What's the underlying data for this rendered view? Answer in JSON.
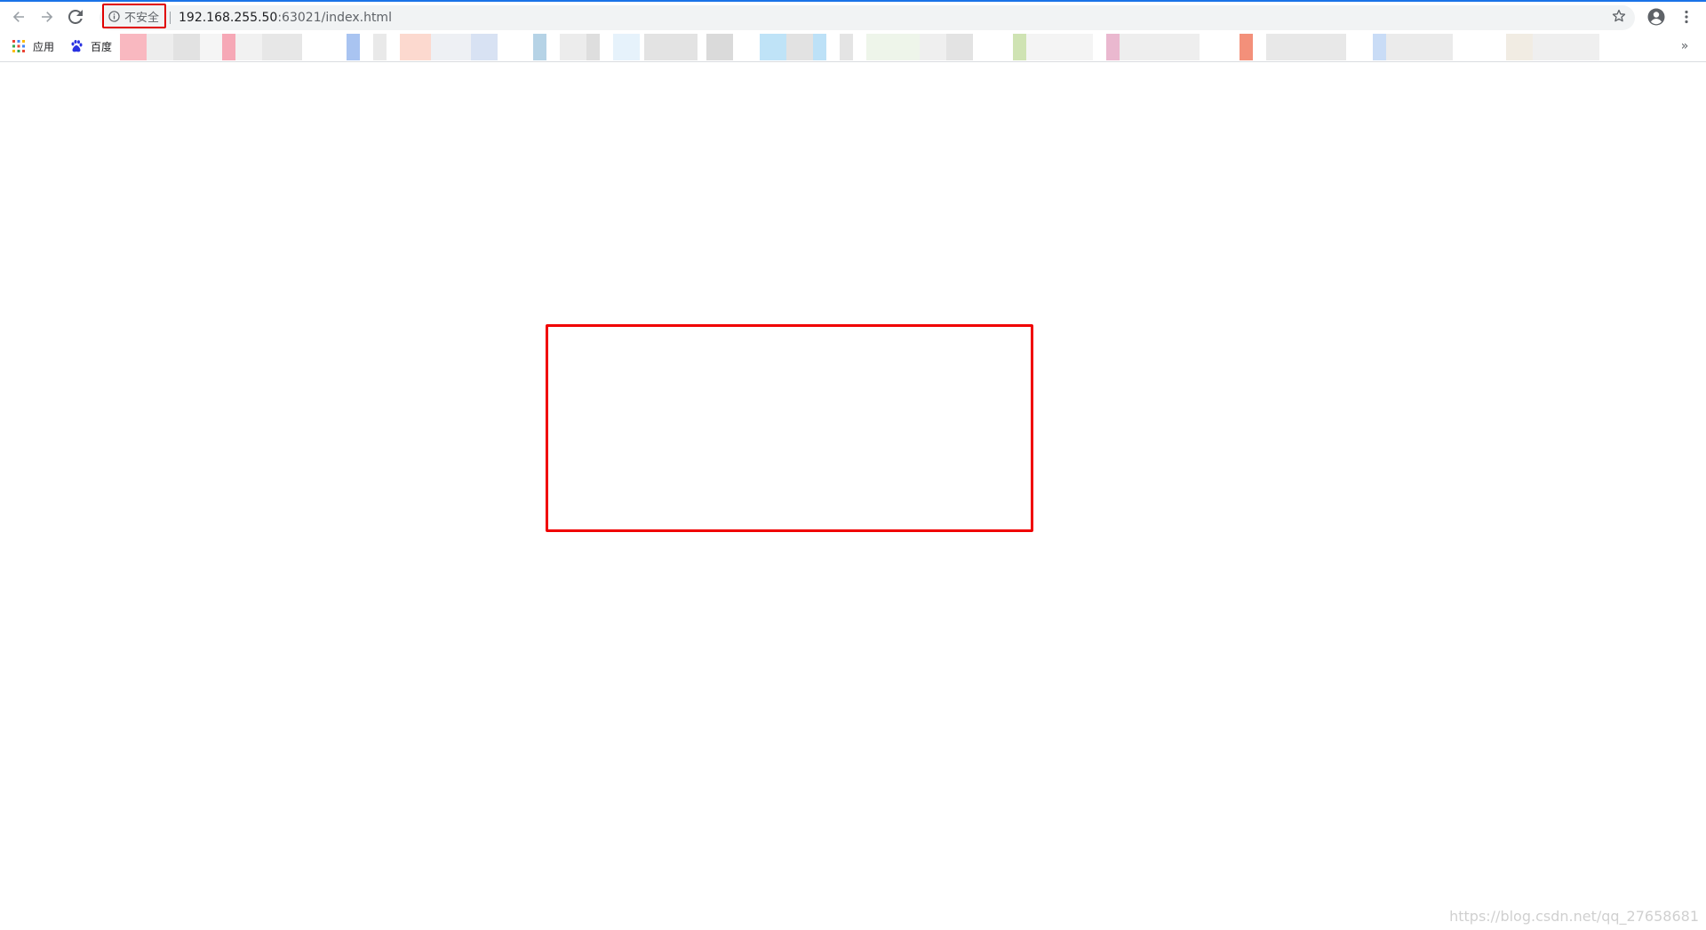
{
  "browser": {
    "url_host": "192.168.255.50",
    "url_path": ":63021/index.html",
    "security_label": "不安全",
    "accent_color": "#1a73e8",
    "highlight_color": "#f00000"
  },
  "toolbar": {
    "back_icon": "back-arrow-icon",
    "forward_icon": "forward-arrow-icon",
    "reload_icon": "reload-icon",
    "info_icon": "info-icon",
    "star_icon": "star-icon",
    "profile_icon": "profile-icon",
    "menu_icon": "kebab-menu-icon"
  },
  "bookmarks": {
    "apps_label": "应用",
    "baidu_label": "百度",
    "overflow_label": "»"
  },
  "page": {
    "watermark": "https://blog.csdn.net/qq_27658681"
  }
}
